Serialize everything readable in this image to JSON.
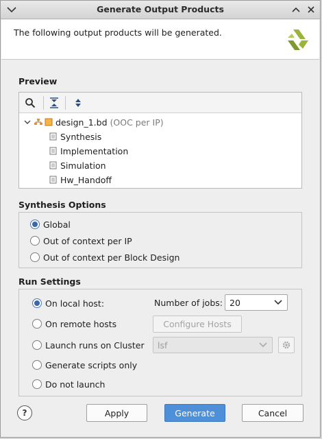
{
  "window": {
    "title": "Generate Output Products",
    "minimize_glyph": "⌃",
    "close_glyph": "✕"
  },
  "header": {
    "text": "The following output products will be generated.",
    "logo_icon": "xilinx-logo-icon"
  },
  "preview": {
    "title": "Preview",
    "toolbar": [
      {
        "name": "search-icon"
      },
      {
        "name": "collapse-all-icon"
      },
      {
        "name": "expand-all-icon"
      }
    ],
    "tree": {
      "root": {
        "label": "design_1.bd",
        "suffix": "(OOC per IP)"
      },
      "children": [
        "Synthesis",
        "Implementation",
        "Simulation",
        "Hw_Handoff"
      ]
    }
  },
  "synthesis_options": {
    "title": "Synthesis Options",
    "options": [
      {
        "label": "Global",
        "checked": true
      },
      {
        "label": "Out of context per IP",
        "checked": false
      },
      {
        "label": "Out of context per Block Design",
        "checked": false
      }
    ]
  },
  "run_settings": {
    "title": "Run Settings",
    "options": [
      {
        "label": "On local host:",
        "checked": true
      },
      {
        "label": "On remote hosts",
        "checked": false
      },
      {
        "label": "Launch runs on Cluster",
        "checked": false
      },
      {
        "label": "Generate scripts only",
        "checked": false
      },
      {
        "label": "Do not launch",
        "checked": false
      }
    ],
    "jobs_label": "Number of jobs:",
    "jobs_value": "20",
    "configure_hosts_label": "Configure Hosts",
    "cluster_value": "lsf"
  },
  "footer": {
    "help_label": "?",
    "apply_label": "Apply",
    "generate_label": "Generate",
    "cancel_label": "Cancel"
  },
  "colors": {
    "accent": "#4d8fd8",
    "radio_checked": "#3a69a8",
    "logo_green": "#9bb43a",
    "logo_orange": "#e8902c"
  }
}
